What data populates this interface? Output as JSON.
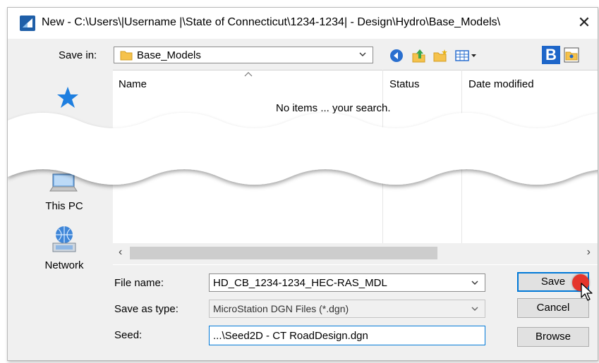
{
  "window": {
    "title": "New - C:\\Users\\|Username |\\State of Connecticut\\1234-1234| - Design\\Hydro\\Base_Models\\",
    "close_glyph": "✕",
    "app_icon": "microstation-app-icon",
    "close_icon": "close-icon"
  },
  "save_in": {
    "label": "Save in:",
    "value": "Base_Models",
    "folder_icon": "folder-icon"
  },
  "toolbar": {
    "icons": [
      "back-icon",
      "up-folder-icon",
      "new-folder-icon",
      "view-menu-icon",
      "b-icon",
      "config-folder-icon"
    ],
    "b_glyph": "B"
  },
  "nav": {
    "items": [
      {
        "label": "This PC",
        "icon": "computer-icon"
      },
      {
        "label": "Network",
        "icon": "network-icon"
      }
    ],
    "quick_access_icon": "star-icon"
  },
  "file_list": {
    "columns": [
      "Name",
      "Status",
      "Date modified"
    ],
    "empty_message_visible": "No items ... your search."
  },
  "form": {
    "file_name_label": "File name:",
    "file_name_value": "HD_CB_1234-1234_HEC-RAS_MDL",
    "save_as_type_label": "Save as type:",
    "save_as_type_value": "MicroStation DGN Files (*.dgn)",
    "seed_label": "Seed:",
    "seed_value": "...\\Seed2D - CT RoadDesign.dgn"
  },
  "buttons": {
    "save": "Save",
    "cancel": "Cancel",
    "browse": "Browse"
  },
  "colors": {
    "accent": "#0078d7",
    "highlight_dot": "#e5352b",
    "folder": "#f5c24c"
  }
}
